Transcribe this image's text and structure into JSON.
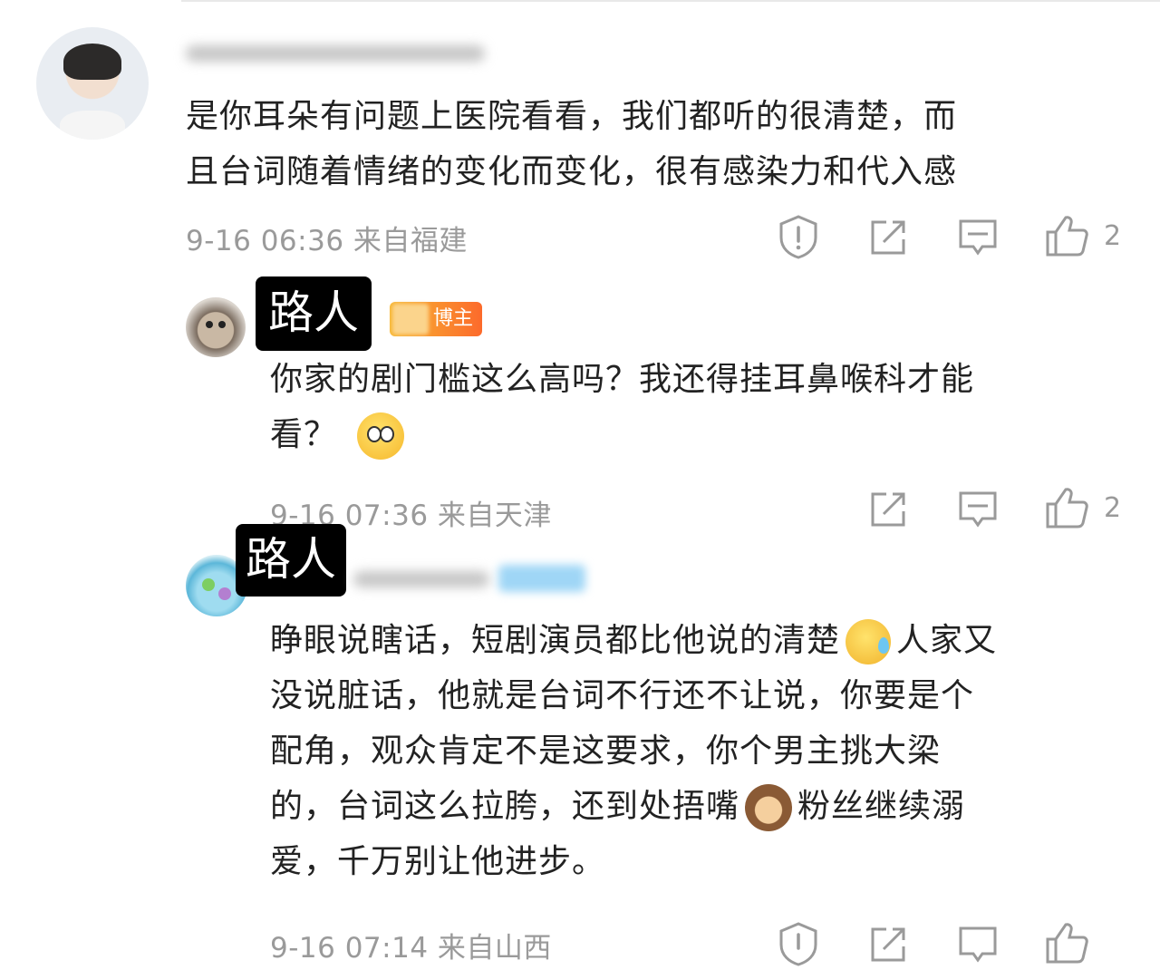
{
  "comments": [
    {
      "text_lines": [
        "是你耳朵有问题上医院看看，我们都听的很清楚，而",
        "且台词随着情绪的变化而变化，很有感染力和代入感"
      ],
      "meta": "9-16 06:36 来自福建",
      "likes": "2",
      "icons": [
        "report-icon",
        "repost-icon",
        "reply-icon",
        "like-icon"
      ]
    },
    {
      "label": "路人",
      "badge": "博主",
      "text_lines": [
        "你家的剧门槛这么高吗？我还得挂耳鼻喉科才能",
        "看？"
      ],
      "emoji": "shocked-emoji",
      "meta": "9-16 07:36 来自天津",
      "likes": "2",
      "icons": [
        "repost-icon",
        "reply-icon",
        "like-icon"
      ]
    },
    {
      "label": "路人",
      "text_lines": [
        [
          "睁眼说瞎话，短剧演员都比他说的清楚",
          "人家又"
        ],
        "没说脏话，他就是台词不行还不让说，你要是个",
        "配角，观众肯定不是这要求，你个男主挑大梁",
        [
          "的，台词这么拉胯，还到处捂嘴",
          "粉丝继续溺"
        ],
        "爱，千万别让他进步。"
      ],
      "emojis": [
        "sweat-emoji",
        "see-no-evil-monkey-emoji"
      ],
      "meta": "9-16 07:14 来自山西",
      "icons": [
        "report-icon",
        "repost-icon",
        "reply-icon",
        "like-icon"
      ]
    }
  ]
}
